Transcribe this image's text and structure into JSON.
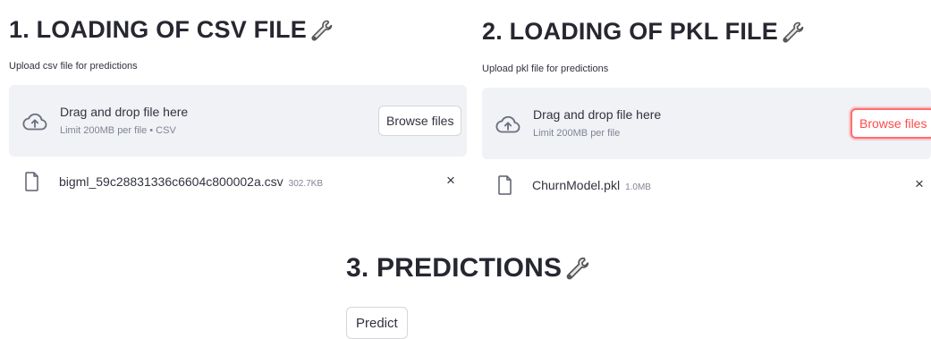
{
  "csv_section": {
    "heading": "1. LOADING OF CSV FILE",
    "heading_icon": "wrench-icon",
    "uploader_label": "Upload csv file for predictions",
    "dropzone": {
      "icon": "cloud-upload-icon",
      "title": "Drag and drop file here",
      "limit": "Limit 200MB per file • CSV",
      "browse_label": "Browse files"
    },
    "uploaded_file": {
      "icon": "file-icon",
      "name": "bigml_59c28831336c6604c800002a.csv",
      "size": "302.7KB",
      "remove_label": "×"
    }
  },
  "pkl_section": {
    "heading": "2. LOADING OF PKL FILE",
    "heading_icon": "wrench-icon",
    "uploader_label": "Upload pkl file for predictions",
    "dropzone": {
      "icon": "cloud-upload-icon",
      "title": "Drag and drop file here",
      "limit": "Limit 200MB per file",
      "browse_label": "Browse files"
    },
    "uploaded_file": {
      "icon": "file-icon",
      "name": "ChurnModel.pkl",
      "size": "1.0MB",
      "remove_label": "×"
    }
  },
  "predictions_section": {
    "heading": "3. PREDICTIONS",
    "heading_icon": "wrench-icon",
    "predict_label": "Predict"
  },
  "colors": {
    "dropzone_bg": "#f0f2f6",
    "focus_accent": "#ff4b4b",
    "muted_text": "#808495"
  }
}
